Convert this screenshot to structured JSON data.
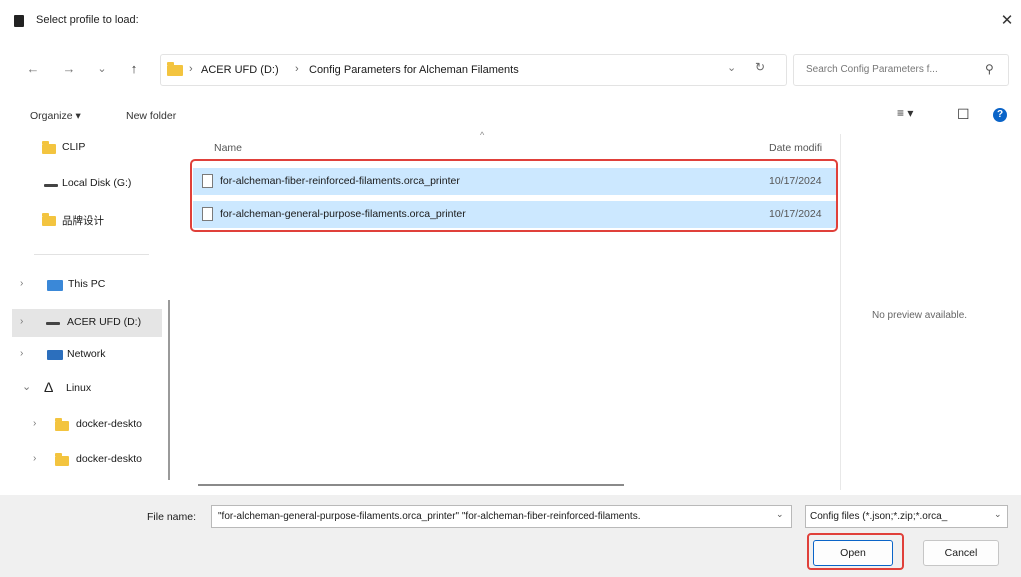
{
  "window": {
    "title": "Select profile to load:",
    "close_glyph": "✕"
  },
  "nav": {
    "back_glyph": "←",
    "forward_glyph": "→",
    "dropdown_glyph": "⌄",
    "up_glyph": "↑",
    "crumb_sep": "›",
    "breadcrumbs": [
      "ACER UFD (D:)",
      "Config Parameters for Alcheman Filaments"
    ],
    "address_dropdown_glyph": "⌄",
    "refresh_glyph": "↻",
    "search_placeholder": "Search Config Parameters f...",
    "search_icon_glyph": "⚲"
  },
  "toolbar": {
    "organize": "Organize ▾",
    "new_folder": "New folder",
    "view_glyph": "≡ ▾",
    "pane_glyph": "☐",
    "help_glyph": "?"
  },
  "sidebar": {
    "items": [
      {
        "label": "CLIP",
        "icon": "folder-icon"
      },
      {
        "label": "Local Disk (G:)",
        "icon": "drive-icon"
      },
      {
        "label": "品牌设计",
        "icon": "folder-icon"
      },
      {
        "label": "This PC",
        "icon": "computer-icon",
        "chevron": "›"
      },
      {
        "label": "ACER UFD (D:)",
        "icon": "drive-icon",
        "chevron": "›",
        "selected": true
      },
      {
        "label": "Network",
        "icon": "network-icon",
        "chevron": "›"
      },
      {
        "label": "Linux",
        "icon": "linux-icon",
        "chevron": "⌄"
      },
      {
        "label": "docker-deskto",
        "icon": "folder-icon",
        "chevron": "›"
      },
      {
        "label": "docker-deskto",
        "icon": "folder-icon",
        "chevron": "›"
      }
    ]
  },
  "files": {
    "sort_glyph": "^",
    "columns": {
      "name": "Name",
      "date": "Date modifi"
    },
    "rows": [
      {
        "name": "for-alcheman-fiber-reinforced-filaments.orca_printer",
        "date": "10/17/2024"
      },
      {
        "name": "for-alcheman-general-purpose-filaments.orca_printer",
        "date": "10/17/2024"
      }
    ]
  },
  "preview": {
    "text": "No preview available."
  },
  "footer": {
    "file_name_label": "File name:",
    "file_name_value": "\"for-alcheman-general-purpose-filaments.orca_printer\" \"for-alcheman-fiber-reinforced-filaments.",
    "file_name_chevron": "⌄",
    "file_type_value": "Config files (*.json;*.zip;*.orca_",
    "file_type_chevron": "⌄",
    "open_label": "Open",
    "cancel_label": "Cancel"
  },
  "colors": {
    "accent": "#0a64c8",
    "selection": "#cce8ff",
    "highlight_box": "#e0403a"
  }
}
